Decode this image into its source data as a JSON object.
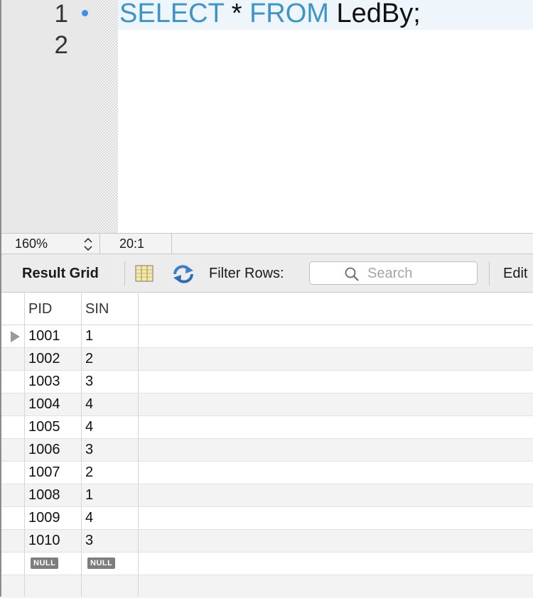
{
  "editor": {
    "line_numbers": [
      "1",
      "2"
    ],
    "code": {
      "kw_select": "SELECT",
      "star": "*",
      "kw_from": "FROM",
      "table": "LedBy;"
    }
  },
  "statusbar": {
    "zoom": "160%",
    "cursor": "20:1"
  },
  "toolbar": {
    "result_grid_label": "Result Grid",
    "filter_label": "Filter Rows:",
    "search_placeholder": "Search",
    "edit_label": "Edit"
  },
  "grid": {
    "columns": [
      "PID",
      "SIN"
    ],
    "rows": [
      {
        "pid": "1001",
        "sin": "1"
      },
      {
        "pid": "1002",
        "sin": "2"
      },
      {
        "pid": "1003",
        "sin": "3"
      },
      {
        "pid": "1004",
        "sin": "4"
      },
      {
        "pid": "1005",
        "sin": "4"
      },
      {
        "pid": "1006",
        "sin": "3"
      },
      {
        "pid": "1007",
        "sin": "2"
      },
      {
        "pid": "1008",
        "sin": "1"
      },
      {
        "pid": "1009",
        "sin": "4"
      },
      {
        "pid": "1010",
        "sin": "3"
      }
    ],
    "null_label": "NULL"
  },
  "colors": {
    "keyword": "#3d94c8",
    "breakpoint": "#3d8ff0",
    "null_badge": "#7d7d7d"
  }
}
